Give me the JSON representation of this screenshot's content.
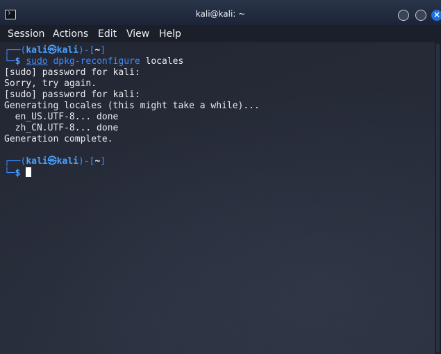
{
  "window": {
    "title": "kali@kali: ~"
  },
  "menu": {
    "items": [
      "Session",
      "Actions",
      "Edit",
      "View",
      "Help"
    ]
  },
  "terminal": {
    "prompt1": {
      "corner_top": "┌──(",
      "user": "kali",
      "at": "㉿",
      "host": "kali",
      "mid": ")-[",
      "dir": "~",
      "end": "]",
      "corner_bottom": "└─",
      "symbol": "$",
      "cmd_sudo": "sudo",
      "cmd_main": "dpkg-reconfigure",
      "cmd_arg": "locales"
    },
    "output": [
      "[sudo] password for kali:",
      "Sorry, try again.",
      "[sudo] password for kali:",
      "Generating locales (this might take a while)...",
      "  en_US.UTF-8... done",
      "  zh_CN.UTF-8... done",
      "Generation complete."
    ],
    "prompt2": {
      "corner_top": "┌──(",
      "user": "kali",
      "at": "㉿",
      "host": "kali",
      "mid": ")-[",
      "dir": "~",
      "end": "]",
      "corner_bottom": "└─",
      "symbol": "$"
    }
  },
  "colors": {
    "prompt_blue": "#3d8bff",
    "close_button": "#1e6fe0"
  }
}
